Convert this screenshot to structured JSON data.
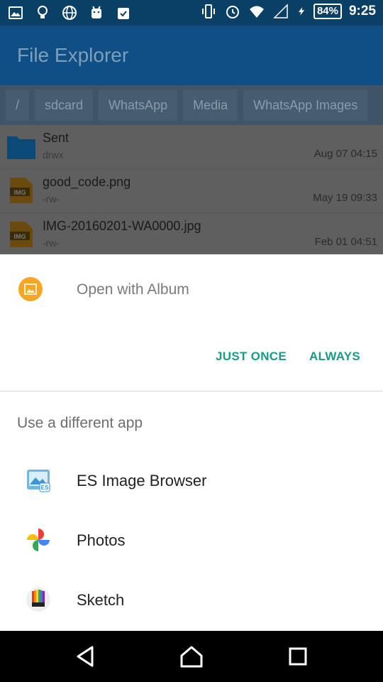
{
  "status_bar": {
    "battery": "84%",
    "time": "9:25"
  },
  "app_bar": {
    "title": "File Explorer"
  },
  "breadcrumbs": [
    "/",
    "sdcard",
    "WhatsApp",
    "Media",
    "WhatsApp Images"
  ],
  "files": [
    {
      "name": "Sent",
      "perm": "drwx",
      "date": "Aug 07 04:15",
      "icon": "folder-icon"
    },
    {
      "name": "good_code.png",
      "perm": "-rw-",
      "date": "May 19 09:33",
      "icon": "image-file-icon"
    },
    {
      "name": "IMG-20160201-WA0000.jpg",
      "perm": "-rw-",
      "date": "Feb 01 04:51",
      "icon": "image-file-icon"
    }
  ],
  "chooser": {
    "open_with": "Open with Album",
    "just_once": "JUST ONCE",
    "always": "ALWAYS",
    "different_app": "Use a different app",
    "apps": [
      {
        "label": "ES Image Browser",
        "icon": "es-image-browser-icon"
      },
      {
        "label": "Photos",
        "icon": "photos-pinwheel-icon"
      },
      {
        "label": "Sketch",
        "icon": "sketch-icon"
      }
    ]
  },
  "colors": {
    "accent": "#1a9a86",
    "status_bar": "#0a3f66",
    "app_bar": "#0f4f84",
    "album_icon": "#f6a623"
  }
}
